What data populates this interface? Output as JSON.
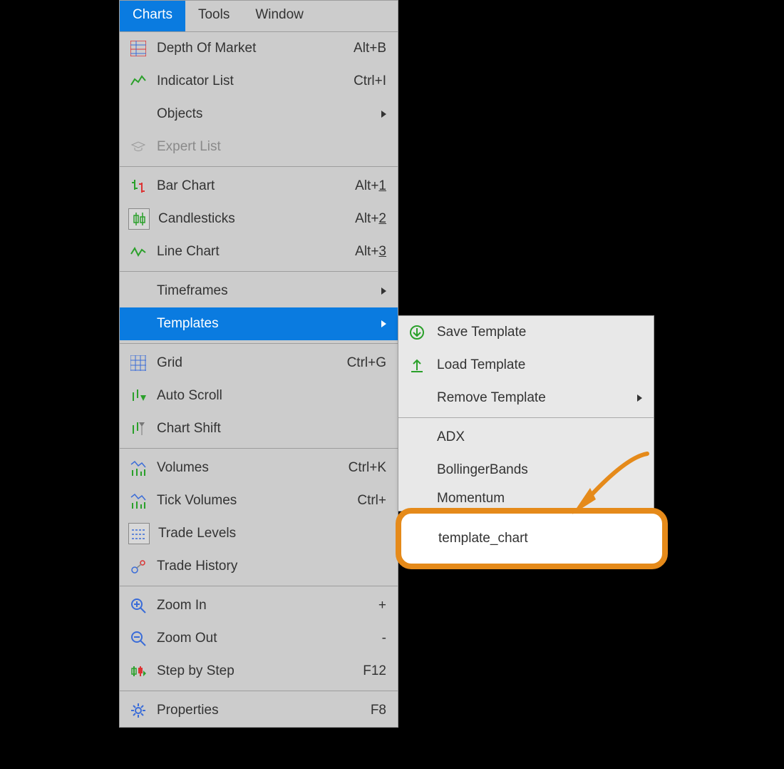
{
  "menubar": {
    "charts": "Charts",
    "tools": "Tools",
    "window": "Window"
  },
  "menu": {
    "depth_of_market": {
      "label": "Depth Of Market",
      "shortcut": "Alt+B"
    },
    "indicator_list": {
      "label": "Indicator List",
      "shortcut": "Ctrl+I"
    },
    "objects": {
      "label": "Objects"
    },
    "expert_list": {
      "label": "Expert List"
    },
    "bar_chart": {
      "label": "Bar Chart",
      "shortcut_prefix": "Alt+",
      "shortcut_key": "1"
    },
    "candlesticks": {
      "label": "Candlesticks",
      "shortcut_prefix": "Alt+",
      "shortcut_key": "2"
    },
    "line_chart": {
      "label": "Line Chart",
      "shortcut_prefix": "Alt+",
      "shortcut_key": "3"
    },
    "timeframes": {
      "label": "Timeframes"
    },
    "templates": {
      "label": "Templates"
    },
    "grid": {
      "label": "Grid",
      "shortcut": "Ctrl+G"
    },
    "auto_scroll": {
      "label": "Auto Scroll"
    },
    "chart_shift": {
      "label": "Chart Shift"
    },
    "volumes": {
      "label": "Volumes",
      "shortcut": "Ctrl+K"
    },
    "tick_volumes": {
      "label": "Tick Volumes",
      "shortcut": "Ctrl+"
    },
    "trade_levels": {
      "label": "Trade Levels"
    },
    "trade_history": {
      "label": "Trade History"
    },
    "zoom_in": {
      "label": "Zoom In",
      "shortcut": "+"
    },
    "zoom_out": {
      "label": "Zoom Out",
      "shortcut": "-"
    },
    "step_by_step": {
      "label": "Step by Step",
      "shortcut": "F12"
    },
    "properties": {
      "label": "Properties",
      "shortcut": "F8"
    }
  },
  "submenu": {
    "save_template": "Save Template",
    "load_template": "Load Template",
    "remove_template": "Remove Template",
    "adx": "ADX",
    "bollinger": "BollingerBands",
    "momentum": "Momentum",
    "template_chart": "template_chart"
  }
}
